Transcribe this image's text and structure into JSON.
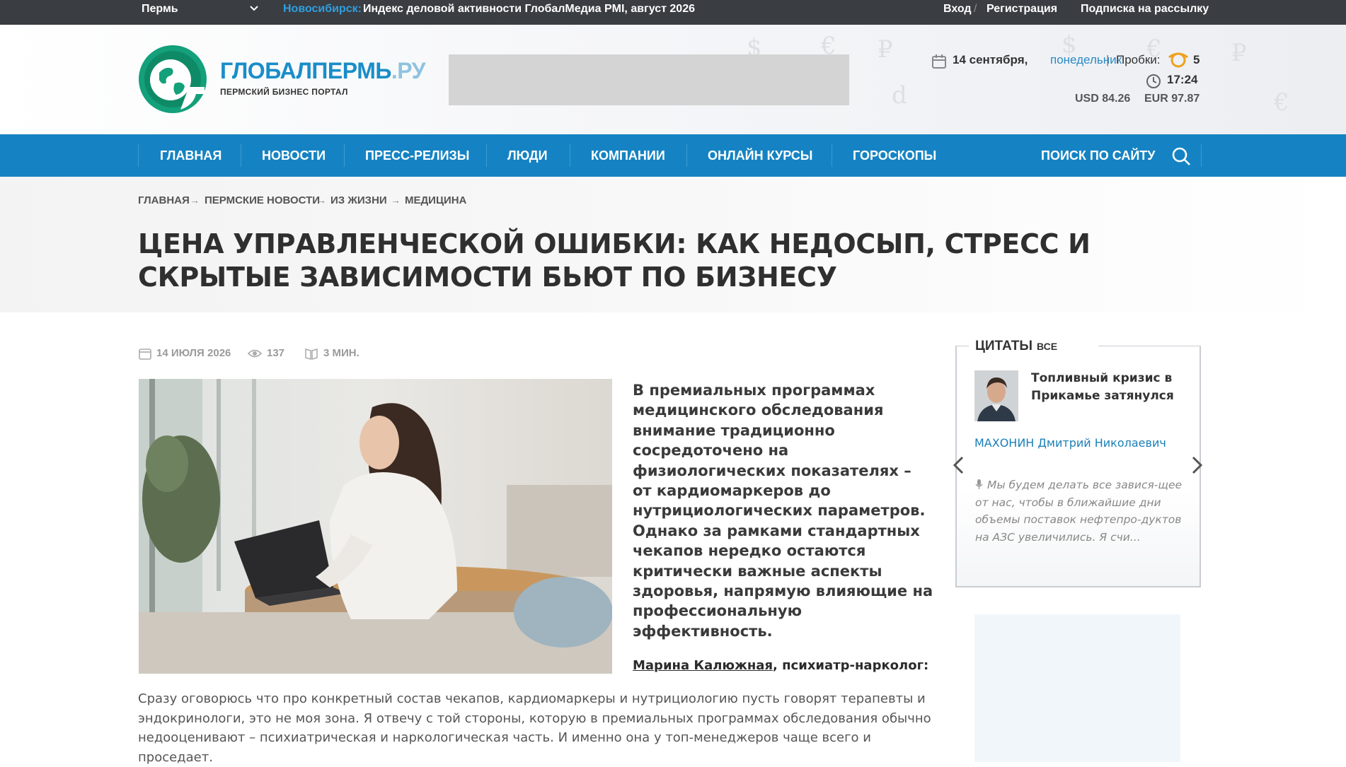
{
  "topbar": {
    "city": "Пермь",
    "ticker_source": "Новосибирск:",
    "ticker_text": "Индекс деловой активности ГлобалМедиа PMI, август 2026",
    "login": "Вход",
    "separator": "/",
    "register": "Регистрация",
    "subscribe": "Подписка на рассылку"
  },
  "header": {
    "logo_title": "ГЛОБАЛПЕРМЬ",
    "logo_title_suffix": ".РУ",
    "logo_subtitle": "ПЕРМСКИЙ БИЗНЕС ПОРТАЛ",
    "date": "14 сентября,",
    "weekday": "понедельник",
    "pipe": "|",
    "traffic_label": "Пробки:",
    "traffic_value": "5",
    "time": "17:24",
    "usd": "USD 84.26",
    "eur": "EUR 97.87",
    "colors": {
      "brand_blue": "#1583c3",
      "accent_orange": "#f0a020"
    }
  },
  "nav": {
    "items": [
      "ГЛАВНАЯ",
      "НОВОСТИ",
      "ПРЕСС-РЕЛИЗЫ",
      "ЛЮДИ",
      "КОМПАНИИ",
      "ОНЛАЙН КУРСЫ",
      "ГОРОСКОПЫ"
    ],
    "search_label": "ПОИСК ПО САЙТУ"
  },
  "breadcrumb": {
    "items": [
      "ГЛАВНАЯ",
      "ПЕРМСКИЕ НОВОСТИ",
      "ИЗ ЖИЗНИ",
      "МЕДИЦИНА"
    ],
    "arrow": "→"
  },
  "article": {
    "title": "ЦЕНА УПРАВЛЕНЧЕСКОЙ ОШИБКИ: КАК НЕДОСЫП, СТРЕСС И СКРЫТЫЕ ЗАВИСИМОСТИ БЬЮТ ПО БИЗНЕСУ",
    "date": "14 ИЮЛЯ 2026",
    "views": "137",
    "read_time": "3 МИН.",
    "lead": "В премиальных программах медицинского обследования внимание традиционно сосредоточено на физиологических показателях – от кардиомаркеров до нутрициологических параметров. Однако за рамками стандартных чекапов нередко остаются критически важные аспекты здоровья, напрямую влияющие на профессиональную эффективность.",
    "author_name": "Марина Калюжная",
    "author_role": ", психиатр-нарколог:",
    "body": "Сразу оговорюсь что про конкретный состав чекапов, кардиомаркеры и нутрициологию пусть говорят терапевты и эндокринологи, это не моя зона. Я отвечу с той стороны, которую в премиальных программах обследования обычно недооценивают – психиатрическая и наркологическая часть. И именно она у топ-менеджеров чаще всего и проседает."
  },
  "quotes": {
    "heading": "ЦИТАТЫ",
    "all_link": "ВСЕ",
    "topic": "Топливный кризис в Прикамье затянулся",
    "person": "МАХОНИН Дмитрий Николаевич",
    "text": "Мы будем делать все завися-щее от нас, чтобы в ближайшие дни объемы поставок нефтепро-дуктов на АЗС увеличились. Я счи..."
  }
}
